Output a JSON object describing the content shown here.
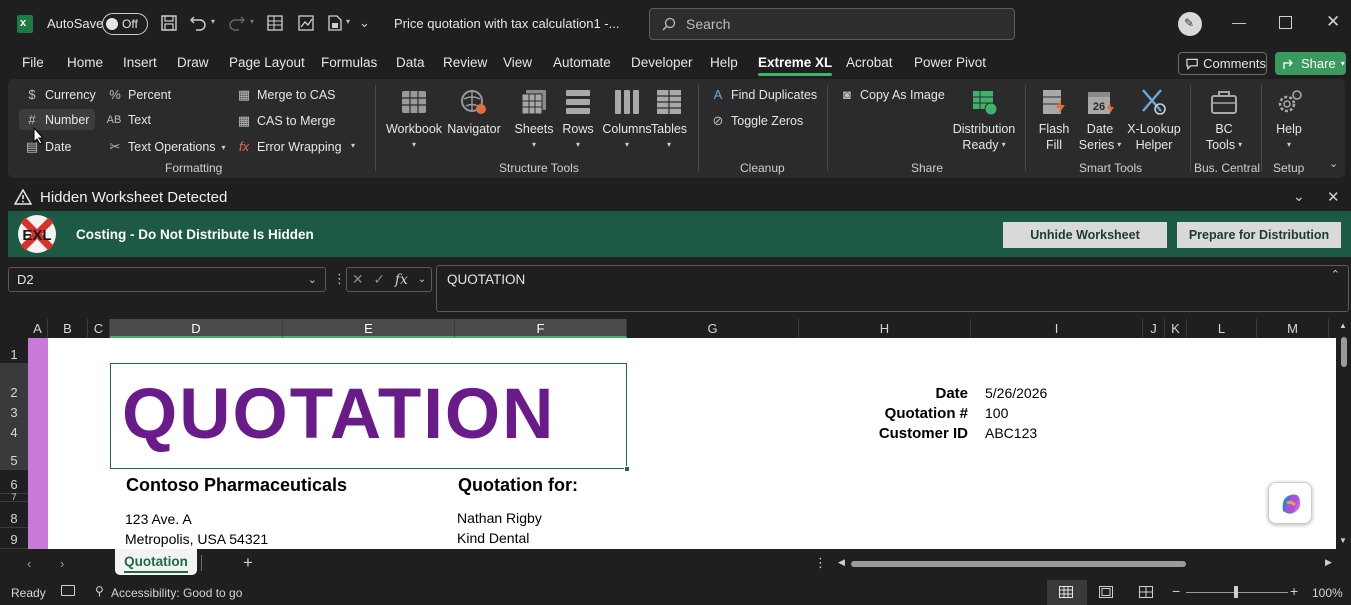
{
  "app": {
    "autosave_label": "AutoSave",
    "autosave_state": "Off",
    "title": "Price quotation with tax calculation1  -...",
    "search_placeholder": "Search"
  },
  "menu": {
    "items": [
      "File",
      "Home",
      "Insert",
      "Draw",
      "Page Layout",
      "Formulas",
      "Data",
      "Review",
      "View",
      "Automate",
      "Developer",
      "Help",
      "Extreme XL",
      "Acrobat",
      "Power Pivot"
    ],
    "active": "Extreme XL",
    "comments_label": "Comments",
    "share_label": "Share"
  },
  "ribbon": {
    "formatting": {
      "currency": "Currency",
      "percent": "Percent",
      "merge_to_cas": "Merge to CAS",
      "number": "Number",
      "text": "Text",
      "cas_to_merge": "CAS to Merge",
      "date": "Date",
      "text_operations": "Text Operations",
      "error_wrapping": "Error Wrapping",
      "label": "Formatting"
    },
    "structure": {
      "workbook": "Workbook",
      "navigator": "Navigator",
      "sheets": "Sheets",
      "rows": "Rows",
      "columns": "Columns",
      "tables": "Tables",
      "label": "Structure Tools"
    },
    "cleanup": {
      "find_duplicates": "Find Duplicates",
      "toggle_zeros": "Toggle Zeros",
      "label": "Cleanup"
    },
    "share": {
      "copy_as_image": "Copy As Image",
      "distribution_1": "Distribution",
      "distribution_2": "Ready",
      "label": "Share"
    },
    "smart": {
      "flash_1": "Flash",
      "flash_2": "Fill",
      "date_1": "Date",
      "date_2": "Series",
      "xlookup_1": "X-Lookup",
      "xlookup_2": "Helper",
      "label": "Smart Tools"
    },
    "bc": {
      "bc_1": "BC",
      "bc_2": "Tools",
      "label": "Bus. Central"
    },
    "setup": {
      "help": "Help",
      "label": "Setup"
    }
  },
  "banner": {
    "title": "Hidden Worksheet Detected",
    "logo_text": "EXL",
    "message": "Costing - Do Not Distribute Is Hidden",
    "unhide_label": "Unhide Worksheet",
    "prepare_label": "Prepare for Distribution"
  },
  "formula_bar": {
    "name_box": "D2",
    "formula": "QUOTATION"
  },
  "grid": {
    "columns": [
      "A",
      "B",
      "C",
      "D",
      "E",
      "F",
      "G",
      "H",
      "I",
      "J",
      "K",
      "L",
      "M"
    ],
    "rows": [
      "1",
      "2",
      "3",
      "4",
      "5",
      "6",
      "7",
      "8",
      "9"
    ]
  },
  "sheet": {
    "heading": "QUOTATION",
    "date_label": "Date",
    "date_value": "5/26/2026",
    "quotation_label": "Quotation #",
    "quotation_value": "100",
    "customer_label": "Customer ID",
    "customer_value": "ABC123",
    "company": "Contoso Pharmaceuticals",
    "address1": "123 Ave. A",
    "address2": "Metropolis, USA 54321",
    "quotation_for": "Quotation for:",
    "client_name": "Nathan Rigby",
    "client_company": "Kind Dental"
  },
  "tabs": {
    "active_sheet": "Quotation"
  },
  "status": {
    "mode": "Ready",
    "accessibility": "Accessibility: Good to go",
    "zoom": "100%"
  },
  "colors": {
    "accent_green": "#3fb36b",
    "banner_green": "#1d5a43",
    "quotation_purple": "#6a1b8a",
    "sidebar_purple": "#c77ad8",
    "share_green": "#3a9a5e"
  }
}
